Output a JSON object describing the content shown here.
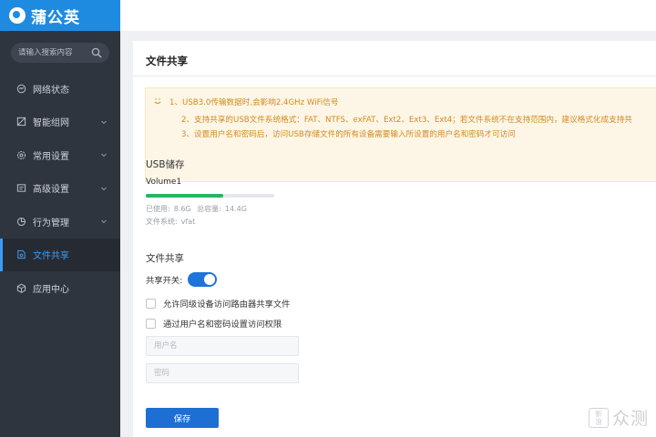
{
  "app": {
    "logo_text": "蒲公英"
  },
  "sidebar": {
    "search_placeholder": "请输入搜索内容",
    "items": [
      {
        "label": "网络状态",
        "icon": "network-status-icon",
        "has_chevron": false,
        "active": false
      },
      {
        "label": "智能组网",
        "icon": "smart-network-icon",
        "has_chevron": true,
        "active": false
      },
      {
        "label": "常用设置",
        "icon": "settings-icon",
        "has_chevron": true,
        "active": false
      },
      {
        "label": "高级设置",
        "icon": "advanced-settings-icon",
        "has_chevron": true,
        "active": false
      },
      {
        "label": "行为管理",
        "icon": "behavior-management-icon",
        "has_chevron": true,
        "active": false
      },
      {
        "label": "文件共享",
        "icon": "file-share-icon",
        "has_chevron": false,
        "active": true
      },
      {
        "label": "应用中心",
        "icon": "app-center-icon",
        "has_chevron": false,
        "active": false
      }
    ]
  },
  "main": {
    "title": "文件共享",
    "notice_lines": [
      "1、USB3.0传输数据时,会影响2.4GHz WiFi信号",
      "2、支持共享的USB文件系统格式：FAT、NTFS、exFAT、Ext2、Ext3、Ext4；若文件系统不在支持范围内，建议格式化成支持共",
      "3、设置用户名和密码后，访问USB存储文件的所有设备需要输入所设置的用户名和密码才可访问"
    ],
    "usb": {
      "section_title": "USB储存",
      "volume_name": "Volume1",
      "used_label": "已使用:",
      "used_value": "8.6G",
      "capacity_label": "总容量:",
      "capacity_value": "14.4G",
      "used_fraction": 0.6,
      "fs_label": "文件系统:",
      "fs_value": "vfat"
    },
    "sharing": {
      "section_title": "文件共享",
      "switch_label": "共享开关:",
      "switch_on": true,
      "option_lan_label": "允许同级设备访问路由器共享文件",
      "option_auth_label": "通过用户名和密码设置访问权限",
      "username_placeholder": "用户名",
      "password_placeholder": "密码"
    },
    "save_label": "保存"
  },
  "watermark": {
    "badge_top": "新",
    "badge_bottom": "浪",
    "text": "众测"
  },
  "colors": {
    "sidebar_bg": "#2f353f",
    "logo_bar": "#1f8be0",
    "active_accent": "#3a9cf5",
    "notice_text": "#d48a1e",
    "progress_fill": "#27b561",
    "toggle_on": "#1e74d9",
    "primary_button": "#1e6fd4"
  }
}
